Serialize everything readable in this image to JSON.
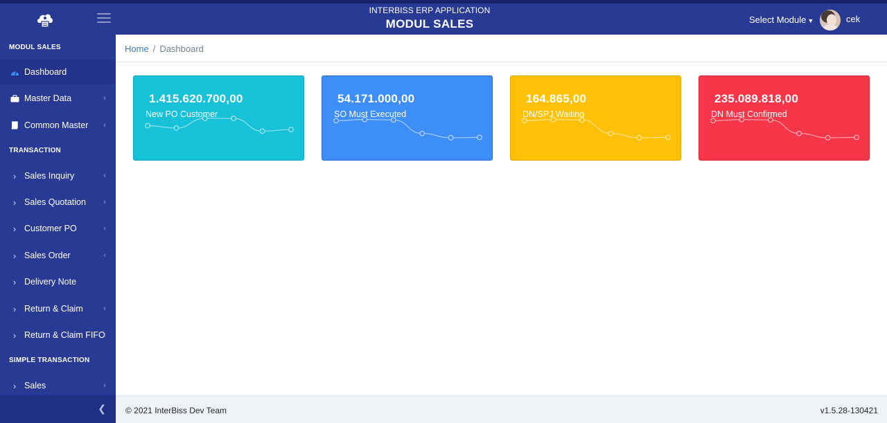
{
  "header": {
    "app_title": "INTERBISS ERP APPLICATION",
    "module_title": "MODUL SALES",
    "module_select": "Select Module",
    "username": "cek",
    "logo_icon": "cloud-logo-icon",
    "menu_icon": "hamburger-icon"
  },
  "sidebar": {
    "sections": [
      "MODUL SALES",
      "TRANSACTION",
      "SIMPLE TRANSACTION"
    ],
    "items": [
      {
        "label": "Dashboard",
        "icon": "speedometer-icon"
      },
      {
        "label": "Master Data",
        "icon": "briefcase-icon"
      },
      {
        "label": "Common Master",
        "icon": "book-icon"
      },
      {
        "label": "Sales Inquiry",
        "icon": "chevron-right-icon"
      },
      {
        "label": "Sales Quotation",
        "icon": "chevron-right-icon"
      },
      {
        "label": "Customer PO",
        "icon": "chevron-right-icon"
      },
      {
        "label": "Sales Order",
        "icon": "chevron-right-icon"
      },
      {
        "label": "Delivery Note",
        "icon": "chevron-right-icon"
      },
      {
        "label": "Return & Claim",
        "icon": "chevron-right-icon"
      },
      {
        "label": "Return & Claim FIFO",
        "icon": "chevron-right-icon"
      },
      {
        "label": "Sales",
        "icon": "chevron-right-icon"
      }
    ]
  },
  "breadcrumb": {
    "home": "Home",
    "separator": "/",
    "current": "Dashboard"
  },
  "cards": [
    {
      "value": "1.415.620.700,00",
      "label": "New PO Customer",
      "color": "#17c1d8",
      "border": "#11a5bb",
      "trend": [
        65,
        59,
        84,
        84,
        51,
        55
      ]
    },
    {
      "value": "54.171.000,00",
      "label": "SO Must Executed",
      "color": "#3e8ef7",
      "border": "#2a6ec9",
      "trend": [
        78,
        81,
        80,
        45,
        34,
        35
      ]
    },
    {
      "value": "164.865,00",
      "label": "DN/SPJ Waiting",
      "color": "#ffc107",
      "border": "#e0a800",
      "trend": [
        78,
        81,
        80,
        45,
        34,
        35
      ]
    },
    {
      "value": "235.089.818,00",
      "label": "DN Must Confirmed",
      "color": "#f83649",
      "border": "#d42a3a",
      "trend": [
        78,
        81,
        80,
        45,
        34,
        35
      ]
    }
  ],
  "footer": {
    "copyright": "© 2021 InterBiss Dev Team",
    "version": "v1.5.28-130421"
  }
}
